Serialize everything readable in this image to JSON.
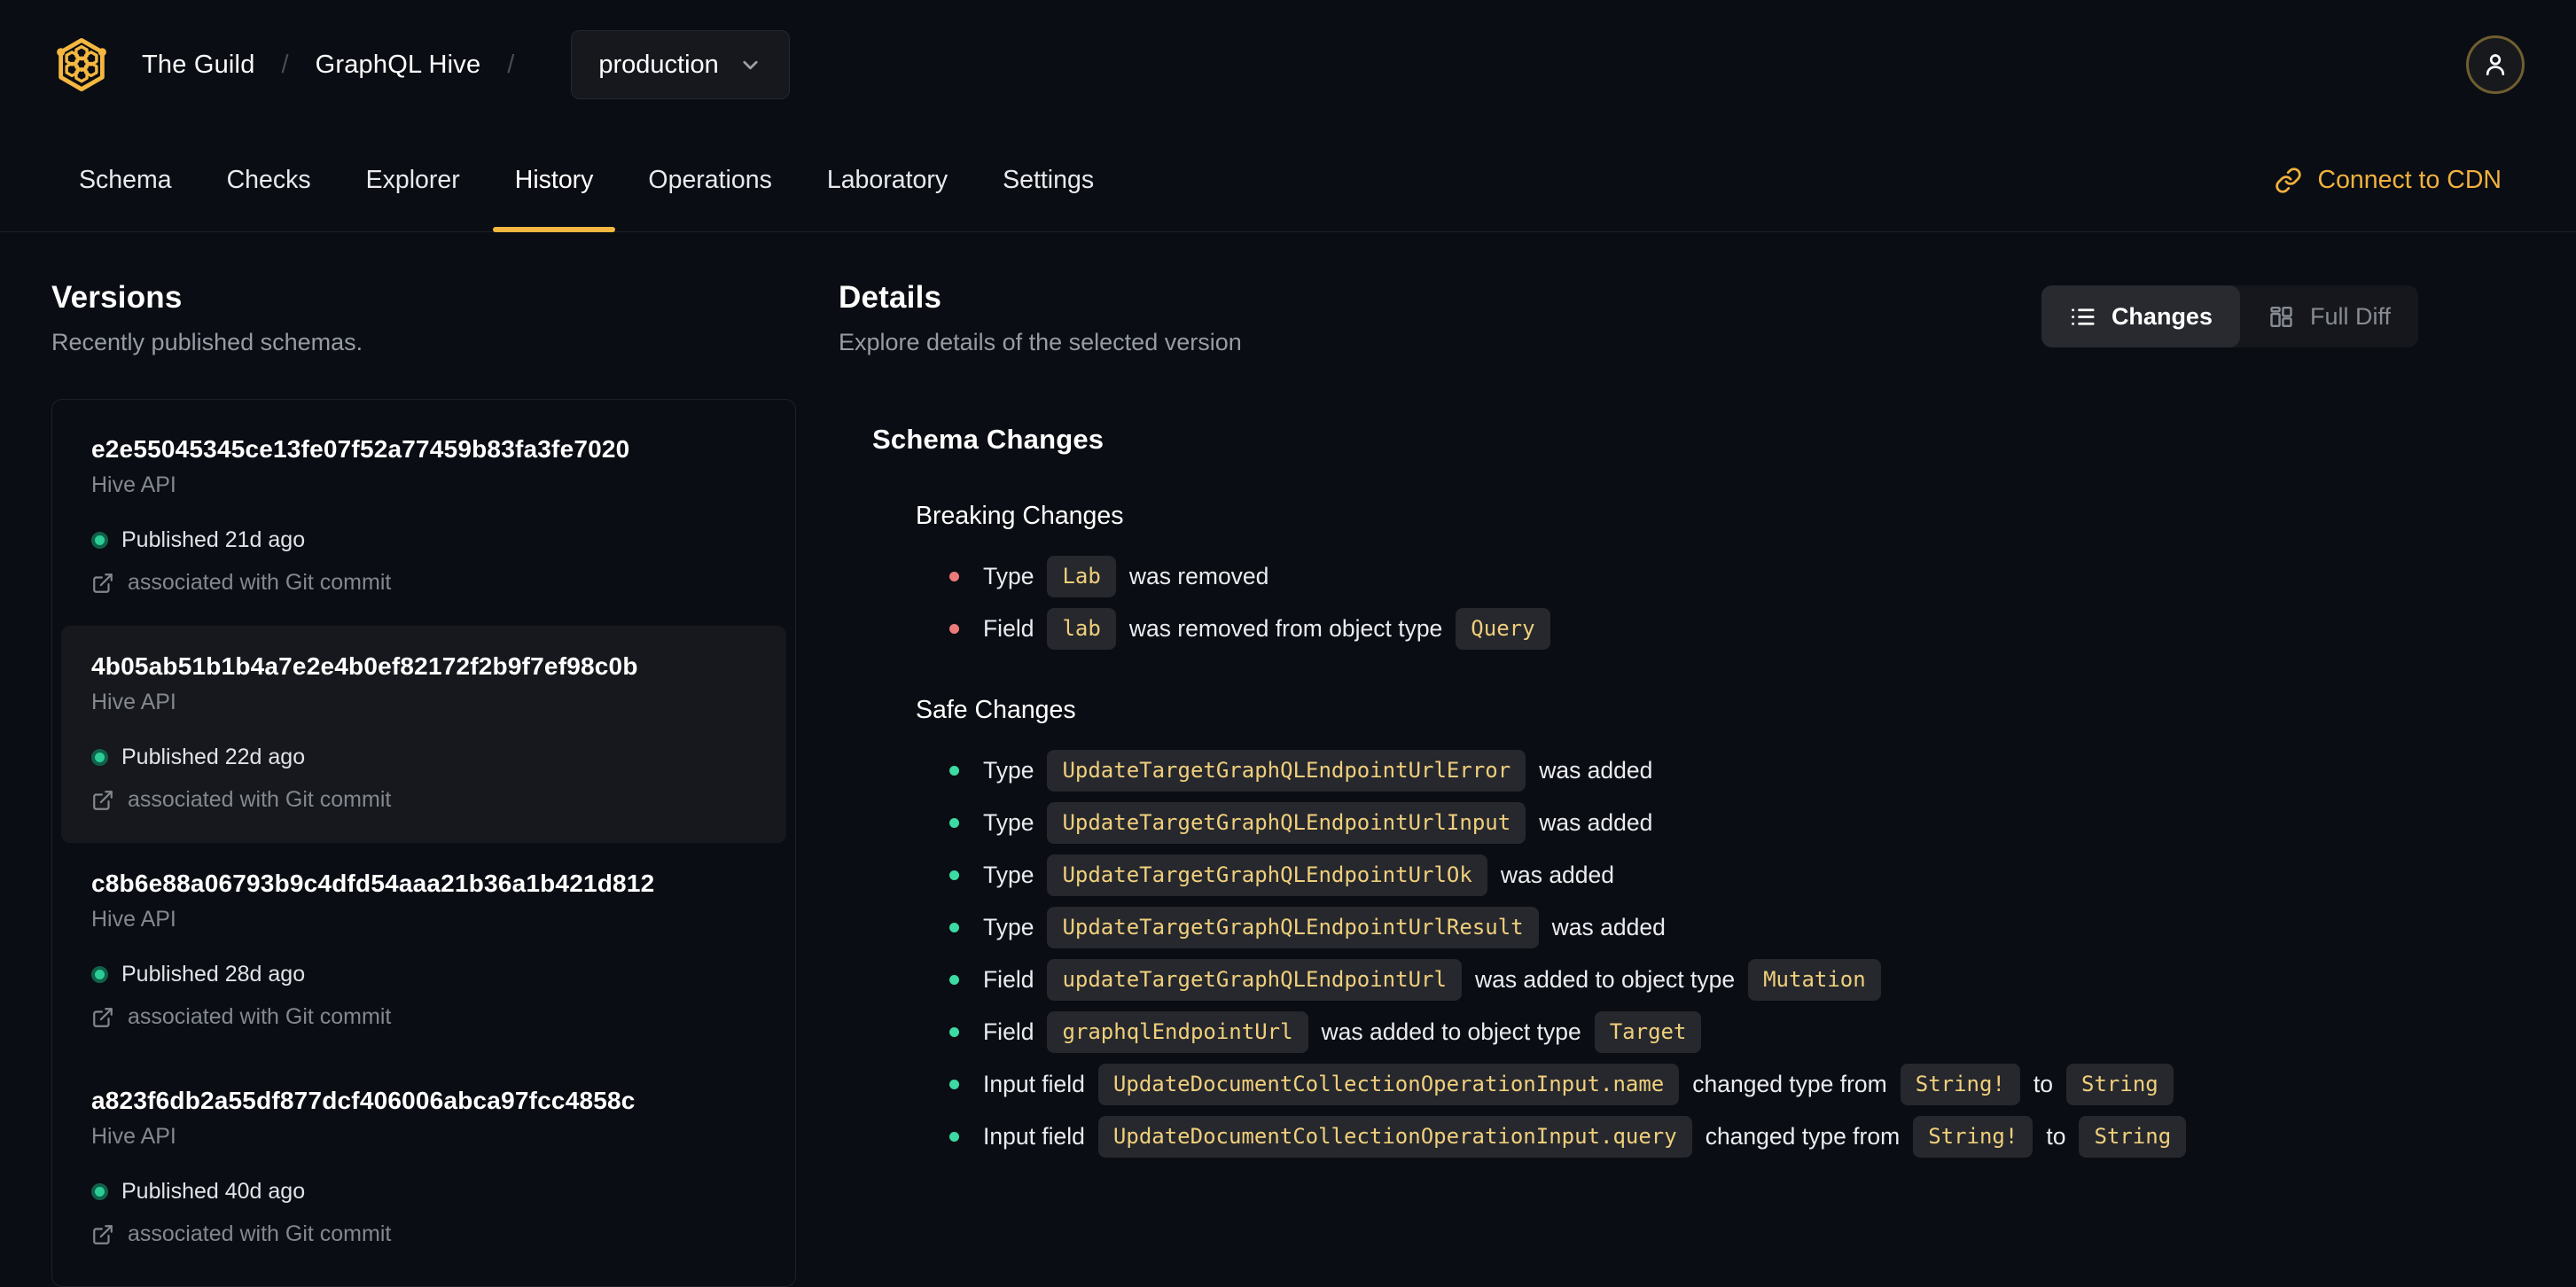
{
  "colors": {
    "accent_gold": "#f4b740",
    "cdn_link_gold": "#f1b13e",
    "code_text": "#f0cf7c",
    "code_badge_bg": "#26282d",
    "breaking_bullet": "#ee7b7b",
    "safe_bullet": "#3ddba4",
    "published_dot": "#2ccd96",
    "background": "#0a0d13"
  },
  "header": {
    "logo_icon": "hive-honeycomb-icon",
    "breadcrumb": {
      "org": "The Guild",
      "separator": "/",
      "project": "GraphQL Hive"
    },
    "target_selector": {
      "value": "production",
      "chevron_icon": "chevron-down-icon"
    },
    "avatar_icon": "user-icon"
  },
  "nav": {
    "tabs": [
      {
        "label": "Schema",
        "active": false
      },
      {
        "label": "Checks",
        "active": false
      },
      {
        "label": "Explorer",
        "active": false
      },
      {
        "label": "History",
        "active": true
      },
      {
        "label": "Operations",
        "active": false
      },
      {
        "label": "Laboratory",
        "active": false
      },
      {
        "label": "Settings",
        "active": false
      }
    ],
    "cdn_link": {
      "label": "Connect to CDN",
      "icon": "link-icon"
    }
  },
  "versions": {
    "title": "Versions",
    "subtitle": "Recently published schemas.",
    "items": [
      {
        "hash": "e2e55045345ce13fe07f52a77459b83fa3fe7020",
        "service": "Hive API",
        "status": "Published 21d ago",
        "git_note": "associated with Git commit",
        "selected": false
      },
      {
        "hash": "4b05ab51b1b4a7e2e4b0ef82172f2b9f7ef98c0b",
        "service": "Hive API",
        "status": "Published 22d ago",
        "git_note": "associated with Git commit",
        "selected": true
      },
      {
        "hash": "c8b6e88a06793b9c4dfd54aaa21b36a1b421d812",
        "service": "Hive API",
        "status": "Published 28d ago",
        "git_note": "associated with Git commit",
        "selected": false
      },
      {
        "hash": "a823f6db2a55df877dcf406006abca97fcc4858c",
        "service": "Hive API",
        "status": "Published 40d ago",
        "git_note": "associated with Git commit",
        "selected": false
      }
    ]
  },
  "details": {
    "title": "Details",
    "subtitle": "Explore details of the selected version",
    "view_toggle": {
      "options": [
        {
          "label": "Changes",
          "icon": "list-icon",
          "active": true
        },
        {
          "label": "Full Diff",
          "icon": "split-view-icon",
          "active": false
        }
      ]
    },
    "schema_changes_title": "Schema Changes",
    "sections": [
      {
        "title": "Breaking Changes",
        "bullet_color": "#ee7b7b",
        "items": [
          {
            "segments": [
              {
                "t": "text",
                "v": "Type"
              },
              {
                "t": "code",
                "v": "Lab"
              },
              {
                "t": "text",
                "v": "was removed"
              }
            ]
          },
          {
            "segments": [
              {
                "t": "text",
                "v": "Field"
              },
              {
                "t": "code",
                "v": "lab"
              },
              {
                "t": "text",
                "v": "was removed from object type"
              },
              {
                "t": "code",
                "v": "Query"
              }
            ]
          }
        ]
      },
      {
        "title": "Safe Changes",
        "bullet_color": "#3ddba4",
        "items": [
          {
            "segments": [
              {
                "t": "text",
                "v": "Type"
              },
              {
                "t": "code",
                "v": "UpdateTargetGraphQLEndpointUrlError"
              },
              {
                "t": "text",
                "v": "was added"
              }
            ]
          },
          {
            "segments": [
              {
                "t": "text",
                "v": "Type"
              },
              {
                "t": "code",
                "v": "UpdateTargetGraphQLEndpointUrlInput"
              },
              {
                "t": "text",
                "v": "was added"
              }
            ]
          },
          {
            "segments": [
              {
                "t": "text",
                "v": "Type"
              },
              {
                "t": "code",
                "v": "UpdateTargetGraphQLEndpointUrlOk"
              },
              {
                "t": "text",
                "v": "was added"
              }
            ]
          },
          {
            "segments": [
              {
                "t": "text",
                "v": "Type"
              },
              {
                "t": "code",
                "v": "UpdateTargetGraphQLEndpointUrlResult"
              },
              {
                "t": "text",
                "v": "was added"
              }
            ]
          },
          {
            "segments": [
              {
                "t": "text",
                "v": "Field"
              },
              {
                "t": "code",
                "v": "updateTargetGraphQLEndpointUrl"
              },
              {
                "t": "text",
                "v": "was added to object type"
              },
              {
                "t": "code",
                "v": "Mutation"
              }
            ]
          },
          {
            "segments": [
              {
                "t": "text",
                "v": "Field"
              },
              {
                "t": "code",
                "v": "graphqlEndpointUrl"
              },
              {
                "t": "text",
                "v": "was added to object type"
              },
              {
                "t": "code",
                "v": "Target"
              }
            ]
          },
          {
            "segments": [
              {
                "t": "text",
                "v": "Input field"
              },
              {
                "t": "code",
                "v": "UpdateDocumentCollectionOperationInput.name"
              },
              {
                "t": "text",
                "v": "changed type from"
              },
              {
                "t": "code",
                "v": "String!"
              },
              {
                "t": "text",
                "v": "to"
              },
              {
                "t": "code",
                "v": "String"
              }
            ]
          },
          {
            "segments": [
              {
                "t": "text",
                "v": "Input field"
              },
              {
                "t": "code",
                "v": "UpdateDocumentCollectionOperationInput.query"
              },
              {
                "t": "text",
                "v": "changed type from"
              },
              {
                "t": "code",
                "v": "String!"
              },
              {
                "t": "text",
                "v": "to"
              },
              {
                "t": "code",
                "v": "String"
              }
            ]
          }
        ]
      }
    ]
  }
}
